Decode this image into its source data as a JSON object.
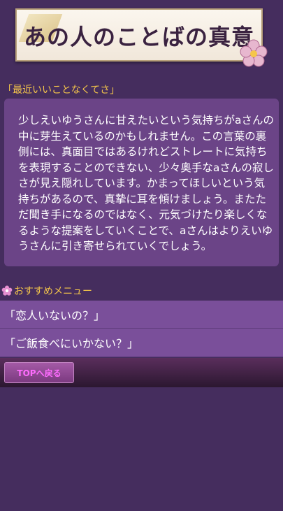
{
  "banner": {
    "title": "あの人のことばの真意"
  },
  "lead_quote": "「最近いいことなくてさ」",
  "message": "少しえいゆうさんに甘えたいという気持ちがaさんの中に芽生えているのかもしれません。この言葉の裏側には、真面目ではあるけれどストレートに気持ちを表現することのできない、少々奥手なaさんの寂しさが見え隠れしています。かまってほしいという気持ちがあるので、真摯に耳を傾けましょう。またただ聞き手になるのではなく、元気づけたり楽しくなるような提案をしていくことで、aさんはよりえいゆうさんに引き寄せられていくでしょう。",
  "recommend": {
    "heading": "おすすめメニュー",
    "icon": "flower-icon",
    "items": [
      {
        "label": "「恋人いないの？」"
      },
      {
        "label": "「ご飯食べにいかない？」"
      }
    ]
  },
  "footer": {
    "top_button": "TOPへ戻る"
  },
  "colors": {
    "background": "#452d5e",
    "panel": "#6b4487",
    "accent": "#f5c64a",
    "button_text": "#ff6cff"
  }
}
